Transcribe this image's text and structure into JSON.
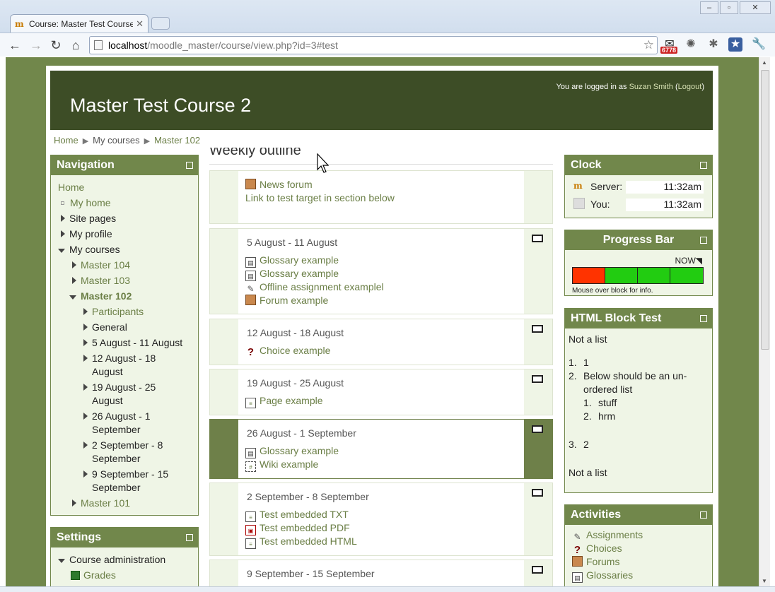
{
  "browser": {
    "tab_title": "Course: Master Test Course",
    "url_host": "localhost",
    "url_path": "/moodle_master/course/view.php?id=3#test",
    "badge_count": "6778"
  },
  "header": {
    "course_title": "Master Test Course 2",
    "login_prefix": "You are logged in as",
    "user_name": "Suzan Smith",
    "logout_label": "Logout"
  },
  "breadcrumb": [
    "Home",
    "My courses",
    "Master 102"
  ],
  "weekly_outline_title": "Weekly outline",
  "navigation": {
    "title": "Navigation",
    "home": "Home",
    "my_home": "My home",
    "site_pages": "Site pages",
    "my_profile": "My profile",
    "my_courses": "My courses",
    "master104": "Master 104",
    "master103": "Master 103",
    "master102": "Master 102",
    "participants": "Participants",
    "general": "General",
    "week1": "5 August - 11 August",
    "week2a": "12 August - 18",
    "week2b": "August",
    "week3a": "19 August - 25",
    "week3b": "August",
    "week4a": "26 August - 1",
    "week4b": "September",
    "week5a": "2 September - 8",
    "week5b": "September",
    "week6a": "9 September - 15",
    "week6b": "September",
    "master101": "Master 101"
  },
  "settings": {
    "title": "Settings",
    "course_admin": "Course administration",
    "grades": "Grades"
  },
  "sections": {
    "s0": {
      "news_forum": "News forum",
      "link_text": "Link to test target in section below"
    },
    "s1": {
      "summary": "5 August - 11 August",
      "a1": "Glossary example",
      "a2": "Glossary example",
      "a3": "Offline assignment examplel",
      "a4": "Forum example"
    },
    "s2": {
      "summary": "12 August - 18 August",
      "a1": "Choice example"
    },
    "s3": {
      "summary": "19 August - 25 August",
      "a1": "Page example"
    },
    "s4": {
      "summary": "26 August - 1 September",
      "a1": "Glossary example",
      "a2": "Wiki example"
    },
    "s5": {
      "summary": "2 September - 8 September",
      "a1": "Test embedded TXT",
      "a2": "Test embedded PDF",
      "a3": "Test embedded HTML"
    },
    "s6": {
      "summary": "9 September - 15 September"
    }
  },
  "clock": {
    "title": "Clock",
    "server_label": "Server:",
    "server_time": "11:32am",
    "you_label": "You:",
    "you_time": "11:32am"
  },
  "progress_bar": {
    "title": "Progress Bar",
    "now_label": "NOW",
    "hint": "Mouse over block for info.",
    "cells": [
      "#ff3300",
      "#22cc11",
      "#22cc11",
      "#22cc11"
    ]
  },
  "html_block": {
    "title": "HTML Block Test",
    "not_a_list_1": "Not a list",
    "item1_num": "1.",
    "item1": "1",
    "item2_num": "2.",
    "item2a": "Below should be an un-",
    "item2b": "ordered list",
    "sub1_num": "1.",
    "sub1": "stuff",
    "sub2_num": "2.",
    "sub2": "hrm",
    "item3_num": "3.",
    "item3": "2",
    "not_a_list_2": "Not a list"
  },
  "activities": {
    "title": "Activities",
    "assignments": "Assignments",
    "choices": "Choices",
    "forums": "Forums",
    "glossaries": "Glossaries"
  },
  "colors": {
    "theme_green": "#71874b",
    "header_dark": "#3d4d26",
    "block_bg": "#eff5e6",
    "link": "#6a7e45"
  }
}
